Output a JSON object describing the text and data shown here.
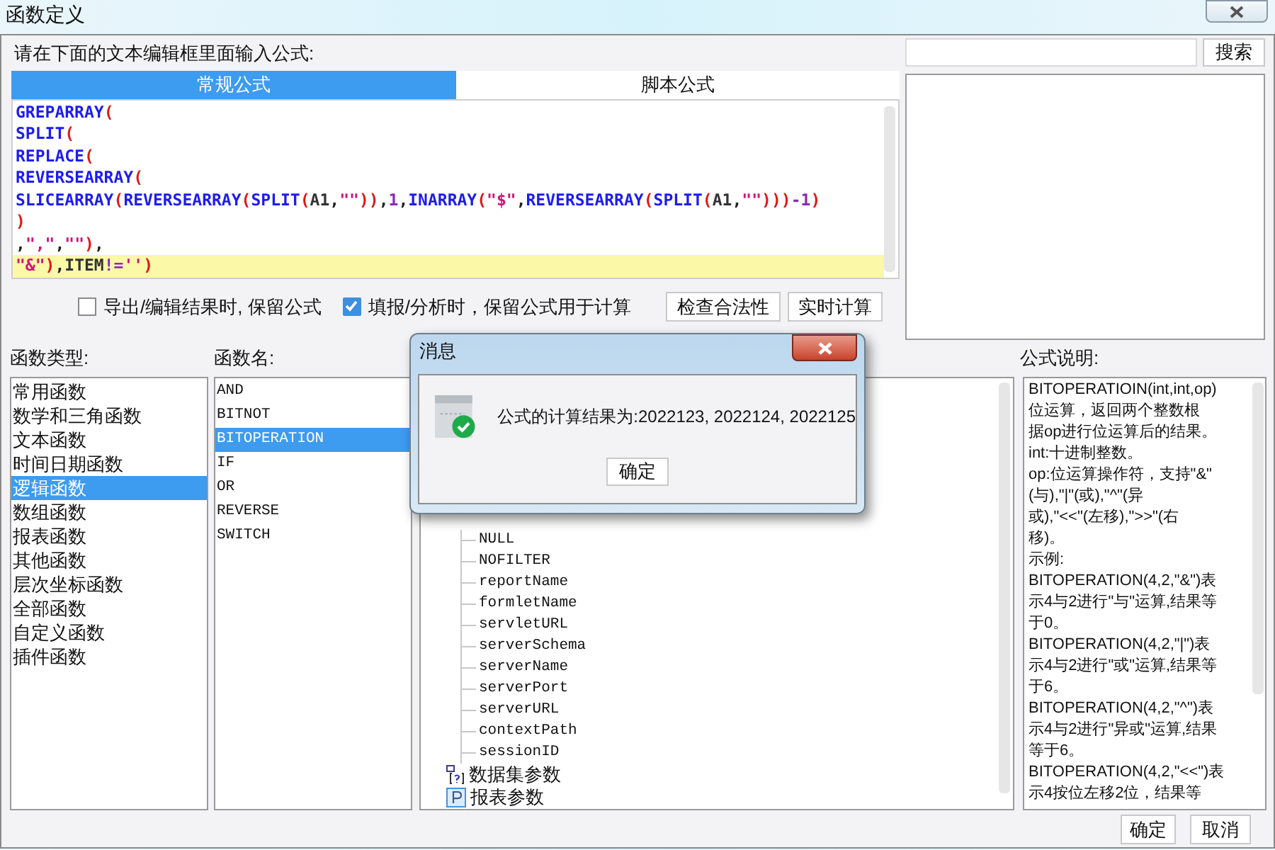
{
  "window": {
    "title": "函数定义"
  },
  "prompt": "请在下面的文本编辑框里面输入公式:",
  "tabs": [
    {
      "label": "常规公式",
      "selected": true
    },
    {
      "label": "脚本公式",
      "selected": false
    }
  ],
  "code_lines": [
    {
      "text": "GREPARRAY(",
      "highlighted": false
    },
    {
      "text": "SPLIT(",
      "highlighted": false
    },
    {
      "text": "REPLACE(",
      "highlighted": false
    },
    {
      "text": "REVERSEARRAY(",
      "highlighted": false
    },
    {
      "text": "SLICEARRAY(REVERSEARRAY(SPLIT(A1,\"\")),1,INARRAY(\"$\",REVERSEARRAY(SPLIT(A1,\"\")))-1)",
      "highlighted": false
    },
    {
      "text": ")",
      "highlighted": false
    },
    {
      "text": ",\",\",\"\"),",
      "highlighted": false
    },
    {
      "text": "\"&\"),ITEM!='')",
      "highlighted": true
    }
  ],
  "options": [
    {
      "label": "导出/编辑结果时, 保留公式",
      "checked": false
    },
    {
      "label": "填报/分析时，保留公式用于计算",
      "checked": true
    }
  ],
  "action_buttons": [
    "检查合法性",
    "实时计算"
  ],
  "search": {
    "button": "搜索"
  },
  "category_label": "函数类型:",
  "categories": [
    {
      "label": "常用函数",
      "selected": false
    },
    {
      "label": "数学和三角函数",
      "selected": false
    },
    {
      "label": "文本函数",
      "selected": false
    },
    {
      "label": "时间日期函数",
      "selected": false
    },
    {
      "label": "逻辑函数",
      "selected": true
    },
    {
      "label": "数组函数",
      "selected": false
    },
    {
      "label": "报表函数",
      "selected": false
    },
    {
      "label": "其他函数",
      "selected": false
    },
    {
      "label": "层次坐标函数",
      "selected": false
    },
    {
      "label": "全部函数",
      "selected": false
    },
    {
      "label": "自定义函数",
      "selected": false
    },
    {
      "label": "插件函数",
      "selected": false
    }
  ],
  "function_label": "函数名:",
  "functions": [
    {
      "label": "AND",
      "selected": false
    },
    {
      "label": "BITNOT",
      "selected": false
    },
    {
      "label": "BITOPERATION",
      "selected": true
    },
    {
      "label": "IF",
      "selected": false
    },
    {
      "label": "OR",
      "selected": false
    },
    {
      "label": "REVERSE",
      "selected": false
    },
    {
      "label": "SWITCH",
      "selected": false
    }
  ],
  "tree": {
    "leaves": [
      "NULL",
      "NOFILTER",
      "reportName",
      "formletName",
      "servletURL",
      "serverSchema",
      "serverName",
      "serverPort",
      "serverURL",
      "contextPath",
      "sessionID"
    ],
    "roots": [
      {
        "label": "数据集参数",
        "kind": "dataset"
      },
      {
        "label": "报表参数",
        "kind": "parameter"
      }
    ]
  },
  "description_label": "公式说明:",
  "description_lines": [
    "BITOPERATIOIN(int,int,op)",
    "位运算，返回两个整数根",
    "据op进行位运算后的结果。",
    "int:十进制整数。",
    "op:位运算操作符，支持\"&\"",
    "(与),\"|\"(或),\"^\"(异",
    "或),\"<<\"(左移),\">>\"(右",
    "移)。",
    "示例:",
    "BITOPERATION(4,2,\"&\")表",
    "示4与2进行\"与\"运算,结果等",
    "于0。",
    "BITOPERATION(4,2,\"|\")表",
    "示4与2进行\"或\"运算,结果等",
    "于6。",
    "BITOPERATION(4,2,\"^\")表",
    "示4与2进行\"异或\"运算,结果",
    "等于6。",
    "BITOPERATION(4,2,\"<<\")表",
    "示4按位左移2位，结果等"
  ],
  "footer_buttons": [
    "确定",
    "取消"
  ],
  "message": {
    "title": "消息",
    "text": "公式的计算结果为:2022123, 2022124, 2022125",
    "button": "确定"
  }
}
